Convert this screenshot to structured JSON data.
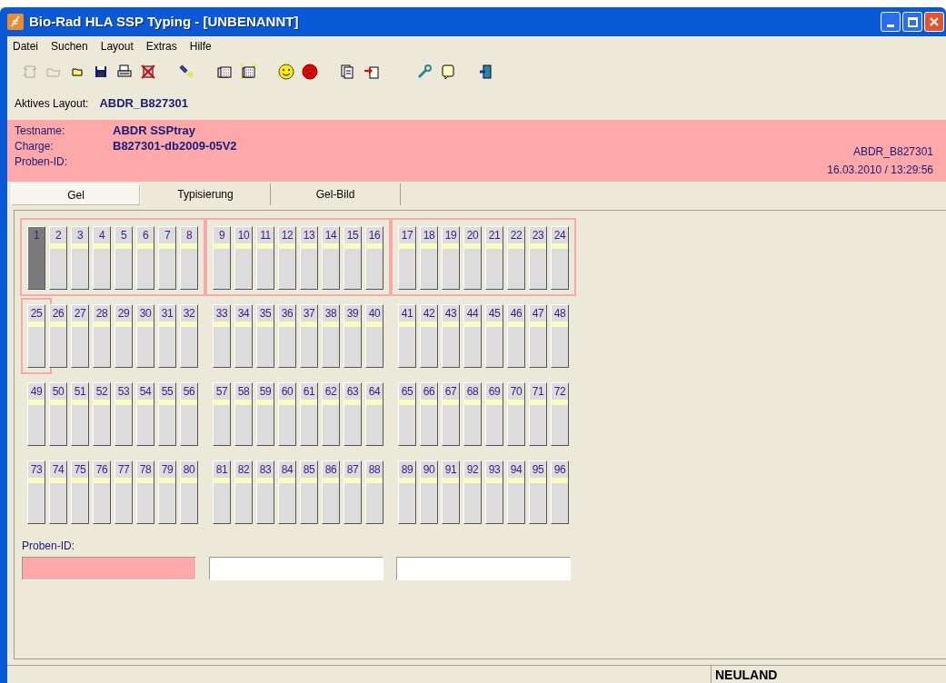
{
  "window": {
    "title": "Bio-Rad HLA SSP Typing - [UNBENANNT]"
  },
  "menu": [
    "Datei",
    "Suchen",
    "Layout",
    "Extras",
    "Hilfe"
  ],
  "active_layout": {
    "label": "Aktives Layout:",
    "value": "ABDR_B827301"
  },
  "header": {
    "fields": [
      {
        "label": "Testname:",
        "value": "ABDR SSPtray"
      },
      {
        "label": "Charge:",
        "value": "B827301-db2009-05V2"
      },
      {
        "label": "Proben-ID:"
      }
    ],
    "layout": "ABDR_B827301",
    "timestamp": "16.03.2010 / 13:29:56"
  },
  "tabs": [
    {
      "label": "Gel",
      "selected": true
    },
    {
      "label": "Typisierung",
      "selected": false
    },
    {
      "label": "Gel-Bild",
      "selected": false
    }
  ],
  "well_groups": [
    {
      "framed": true,
      "wells": [
        {
          "label": "1",
          "selected": true,
          "framed": false
        },
        {
          "label": "2",
          "selected": false,
          "framed": false
        },
        {
          "label": "3",
          "selected": false,
          "framed": false
        },
        {
          "label": "4",
          "selected": false,
          "framed": false
        },
        {
          "label": "5",
          "selected": false,
          "framed": false
        },
        {
          "label": "6",
          "selected": false,
          "framed": false
        },
        {
          "label": "7",
          "selected": false,
          "framed": false
        },
        {
          "label": "8",
          "selected": false,
          "framed": false
        }
      ]
    },
    {
      "framed": true,
      "wells": [
        {
          "label": "9",
          "selected": false,
          "framed": false
        },
        {
          "label": "10",
          "selected": false,
          "framed": false
        },
        {
          "label": "11",
          "selected": false,
          "framed": false
        },
        {
          "label": "12",
          "selected": false,
          "framed": false
        },
        {
          "label": "13",
          "selected": false,
          "framed": false
        },
        {
          "label": "14",
          "selected": false,
          "framed": false
        },
        {
          "label": "15",
          "selected": false,
          "framed": false
        },
        {
          "label": "16",
          "selected": false,
          "framed": false
        }
      ]
    },
    {
      "framed": true,
      "wells": [
        {
          "label": "17",
          "selected": false,
          "framed": false
        },
        {
          "label": "18",
          "selected": false,
          "framed": false
        },
        {
          "label": "19",
          "selected": false,
          "framed": false
        },
        {
          "label": "20",
          "selected": false,
          "framed": false
        },
        {
          "label": "21",
          "selected": false,
          "framed": false
        },
        {
          "label": "22",
          "selected": false,
          "framed": false
        },
        {
          "label": "23",
          "selected": false,
          "framed": false
        },
        {
          "label": "24",
          "selected": false,
          "framed": false
        }
      ]
    },
    {
      "framed": false,
      "wells": [
        {
          "label": "25",
          "selected": false,
          "framed": true
        },
        {
          "label": "26",
          "selected": false,
          "framed": false
        },
        {
          "label": "27",
          "selected": false,
          "framed": false
        },
        {
          "label": "28",
          "selected": false,
          "framed": false
        },
        {
          "label": "29",
          "selected": false,
          "framed": false
        },
        {
          "label": "30",
          "selected": false,
          "framed": false
        },
        {
          "label": "31",
          "selected": false,
          "framed": false
        },
        {
          "label": "32",
          "selected": false,
          "framed": false
        }
      ]
    },
    {
      "framed": false,
      "wells": [
        {
          "label": "33",
          "selected": false,
          "framed": false
        },
        {
          "label": "34",
          "selected": false,
          "framed": false
        },
        {
          "label": "35",
          "selected": false,
          "framed": false
        },
        {
          "label": "36",
          "selected": false,
          "framed": false
        },
        {
          "label": "37",
          "selected": false,
          "framed": false
        },
        {
          "label": "38",
          "selected": false,
          "framed": false
        },
        {
          "label": "39",
          "selected": false,
          "framed": false
        },
        {
          "label": "40",
          "selected": false,
          "framed": false
        }
      ]
    },
    {
      "framed": false,
      "wells": [
        {
          "label": "41",
          "selected": false,
          "framed": false
        },
        {
          "label": "42",
          "selected": false,
          "framed": false
        },
        {
          "label": "43",
          "selected": false,
          "framed": false
        },
        {
          "label": "44",
          "selected": false,
          "framed": false
        },
        {
          "label": "45",
          "selected": false,
          "framed": false
        },
        {
          "label": "46",
          "selected": false,
          "framed": false
        },
        {
          "label": "47",
          "selected": false,
          "framed": false
        },
        {
          "label": "48",
          "selected": false,
          "framed": false
        }
      ]
    },
    {
      "framed": false,
      "wells": [
        {
          "label": "49",
          "selected": false,
          "framed": false
        },
        {
          "label": "50",
          "selected": false,
          "framed": false
        },
        {
          "label": "51",
          "selected": false,
          "framed": false
        },
        {
          "label": "52",
          "selected": false,
          "framed": false
        },
        {
          "label": "53",
          "selected": false,
          "framed": false
        },
        {
          "label": "54",
          "selected": false,
          "framed": false
        },
        {
          "label": "55",
          "selected": false,
          "framed": false
        },
        {
          "label": "56",
          "selected": false,
          "framed": false
        }
      ]
    },
    {
      "framed": false,
      "wells": [
        {
          "label": "57",
          "selected": false,
          "framed": false
        },
        {
          "label": "58",
          "selected": false,
          "framed": false
        },
        {
          "label": "59",
          "selected": false,
          "framed": false
        },
        {
          "label": "60",
          "selected": false,
          "framed": false
        },
        {
          "label": "61",
          "selected": false,
          "framed": false
        },
        {
          "label": "62",
          "selected": false,
          "framed": false
        },
        {
          "label": "63",
          "selected": false,
          "framed": false
        },
        {
          "label": "64",
          "selected": false,
          "framed": false
        }
      ]
    },
    {
      "framed": false,
      "wells": [
        {
          "label": "65",
          "selected": false,
          "framed": false
        },
        {
          "label": "66",
          "selected": false,
          "framed": false
        },
        {
          "label": "67",
          "selected": false,
          "framed": false
        },
        {
          "label": "68",
          "selected": false,
          "framed": false
        },
        {
          "label": "69",
          "selected": false,
          "framed": false
        },
        {
          "label": "70",
          "selected": false,
          "framed": false
        },
        {
          "label": "71",
          "selected": false,
          "framed": false
        },
        {
          "label": "72",
          "selected": false,
          "framed": false
        }
      ]
    },
    {
      "framed": false,
      "wells": [
        {
          "label": "73",
          "selected": false,
          "framed": false
        },
        {
          "label": "74",
          "selected": false,
          "framed": false
        },
        {
          "label": "75",
          "selected": false,
          "framed": false
        },
        {
          "label": "76",
          "selected": false,
          "framed": false
        },
        {
          "label": "77",
          "selected": false,
          "framed": false
        },
        {
          "label": "78",
          "selected": false,
          "framed": false
        },
        {
          "label": "79",
          "selected": false,
          "framed": false
        },
        {
          "label": "80",
          "selected": false,
          "framed": false
        }
      ]
    },
    {
      "framed": false,
      "wells": [
        {
          "label": "81",
          "selected": false,
          "framed": false
        },
        {
          "label": "82",
          "selected": false,
          "framed": false
        },
        {
          "label": "83",
          "selected": false,
          "framed": false
        },
        {
          "label": "84",
          "selected": false,
          "framed": false
        },
        {
          "label": "85",
          "selected": false,
          "framed": false
        },
        {
          "label": "86",
          "selected": false,
          "framed": false
        },
        {
          "label": "87",
          "selected": false,
          "framed": false
        },
        {
          "label": "88",
          "selected": false,
          "framed": false
        }
      ]
    },
    {
      "framed": false,
      "wells": [
        {
          "label": "89",
          "selected": false,
          "framed": false
        },
        {
          "label": "90",
          "selected": false,
          "framed": false
        },
        {
          "label": "91",
          "selected": false,
          "framed": false
        },
        {
          "label": "92",
          "selected": false,
          "framed": false
        },
        {
          "label": "93",
          "selected": false,
          "framed": false
        },
        {
          "label": "94",
          "selected": false,
          "framed": false
        },
        {
          "label": "95",
          "selected": false,
          "framed": false
        },
        {
          "label": "96",
          "selected": false,
          "framed": false
        }
      ]
    }
  ],
  "sample_ids": {
    "label": "Proben-ID:",
    "fields": [
      {
        "selected": true
      },
      {
        "selected": false
      },
      {
        "selected": false
      }
    ]
  },
  "status_bar": {
    "panel": "NEULAND"
  }
}
